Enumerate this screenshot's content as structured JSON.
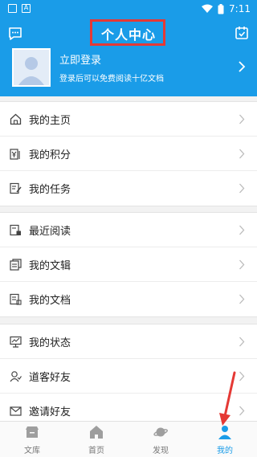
{
  "status_bar": {
    "time": "7:11"
  },
  "header": {
    "title": "个人中心"
  },
  "profile": {
    "login_label": "立即登录",
    "login_sub": "登录后可以免费阅读十亿文档"
  },
  "groups": [
    {
      "items": [
        {
          "label": "我的主页"
        },
        {
          "label": "我的积分"
        },
        {
          "label": "我的任务"
        }
      ]
    },
    {
      "items": [
        {
          "label": "最近阅读"
        },
        {
          "label": "我的文辑"
        },
        {
          "label": "我的文档"
        }
      ]
    },
    {
      "items": [
        {
          "label": "我的状态"
        },
        {
          "label": "道客好友"
        },
        {
          "label": "邀请好友"
        }
      ]
    }
  ],
  "tabs": [
    {
      "label": "文库"
    },
    {
      "label": "首页"
    },
    {
      "label": "发现"
    },
    {
      "label": "我的"
    }
  ],
  "colors": {
    "accent": "#1a9ce8",
    "annotation": "#e53935"
  }
}
